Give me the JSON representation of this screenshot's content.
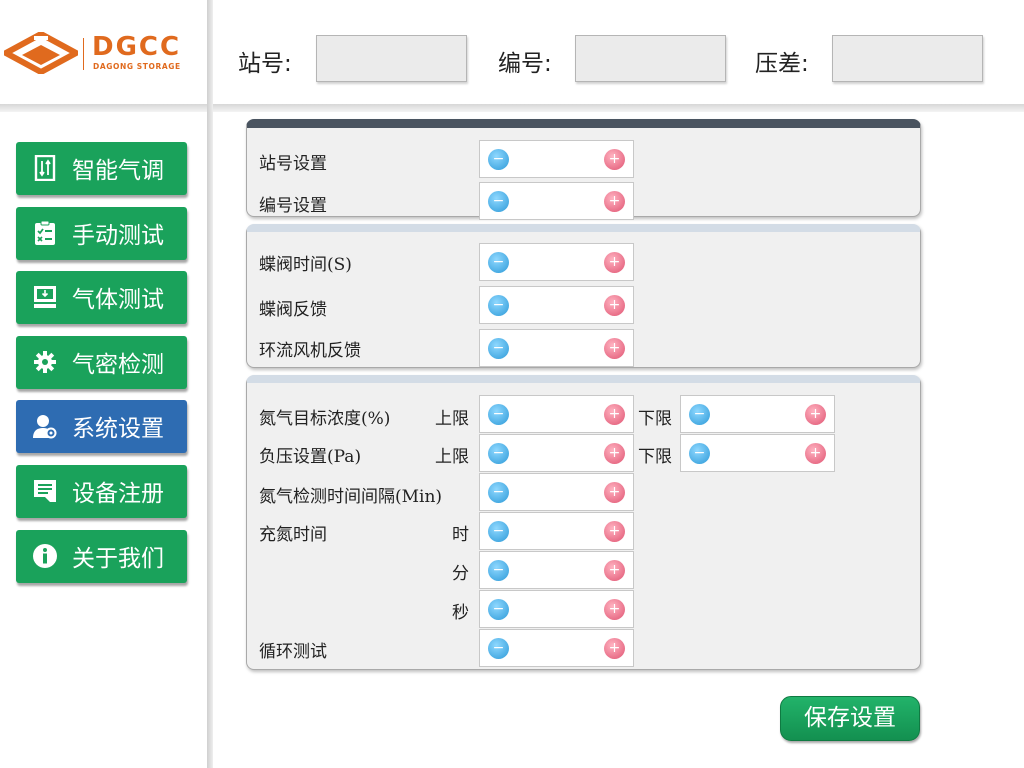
{
  "header": {
    "logo": {
      "name": "DGCC",
      "sub": "DAGONG STORAGE"
    },
    "fields": [
      {
        "label": "站号:",
        "value": ""
      },
      {
        "label": "编号:",
        "value": ""
      },
      {
        "label": "压差:",
        "value": ""
      }
    ]
  },
  "sidebar": {
    "items": [
      {
        "label": "智能气调",
        "icon": "door-swap-icon",
        "active": false
      },
      {
        "label": "手动测试",
        "icon": "clipboard-checklist-icon",
        "active": false
      },
      {
        "label": "气体测试",
        "icon": "monitor-download-icon",
        "active": false
      },
      {
        "label": "气密检测",
        "icon": "gear-icon",
        "active": false
      },
      {
        "label": "系统设置",
        "icon": "user-settings-icon",
        "active": true
      },
      {
        "label": "设备注册",
        "icon": "document-icon",
        "active": false
      },
      {
        "label": "关于我们",
        "icon": "info-icon",
        "active": false
      }
    ],
    "colors": {
      "normal": "#1aa25b",
      "active": "#2e6cb2"
    }
  },
  "panel1": {
    "rows": [
      {
        "label": "站号设置",
        "value": ""
      },
      {
        "label": "编号设置",
        "value": ""
      }
    ]
  },
  "panel2": {
    "rows": [
      {
        "label": "蝶阀时间(S)",
        "value": ""
      },
      {
        "label": "蝶阀反馈",
        "value": ""
      },
      {
        "label": "环流风机反馈",
        "value": ""
      }
    ]
  },
  "panel3": {
    "nitrogen": {
      "label": "氮气目标浓度(%)",
      "upper": "上限",
      "lower": "下限",
      "upper_value": "",
      "lower_value": ""
    },
    "pressure": {
      "label": "负压设置(Pa)",
      "upper": "上限",
      "lower": "下限",
      "upper_value": "",
      "lower_value": ""
    },
    "interval": {
      "label": "氮气检测时间间隔(Min)",
      "value": ""
    },
    "charge": {
      "label": "充氮时间",
      "hour": "时",
      "minute": "分",
      "second": "秒",
      "hour_value": "",
      "minute_value": "",
      "second_value": ""
    },
    "cycle": {
      "label": "循环测试",
      "value": ""
    }
  },
  "stepper": {
    "minus": "−",
    "plus": "+"
  },
  "save_label": "保存设置"
}
